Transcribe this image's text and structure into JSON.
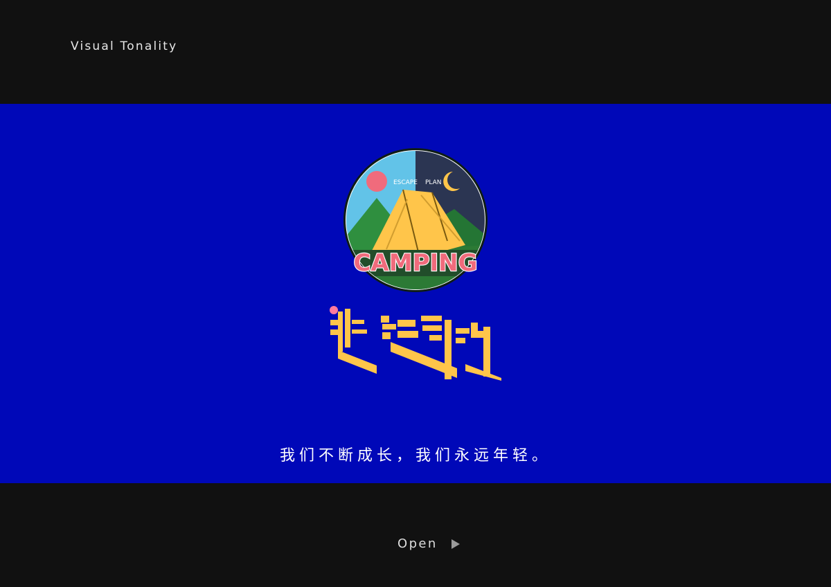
{
  "header": {
    "label": "Visual Tonality"
  },
  "badge": {
    "top_text_left": "ESCAPE",
    "top_text_right": "PLAN",
    "title": "CAMPING",
    "colors": {
      "sky_day": "#62c3e8",
      "sky_night": "#2b3552",
      "sun": "#f06b7c",
      "moon": "#ffc54a",
      "mountain": "#2f8f3f",
      "tent": "#ffc54a",
      "ribbon": "#214d2a",
      "title_text": "#f06b7c"
    }
  },
  "wordmark": {
    "accent_dot_color": "#ff7a9e",
    "bar_color": "#ffc54a"
  },
  "tagline": {
    "text": "我们不断成长，我们永远年轻。"
  },
  "footer": {
    "open_label": "Open"
  }
}
